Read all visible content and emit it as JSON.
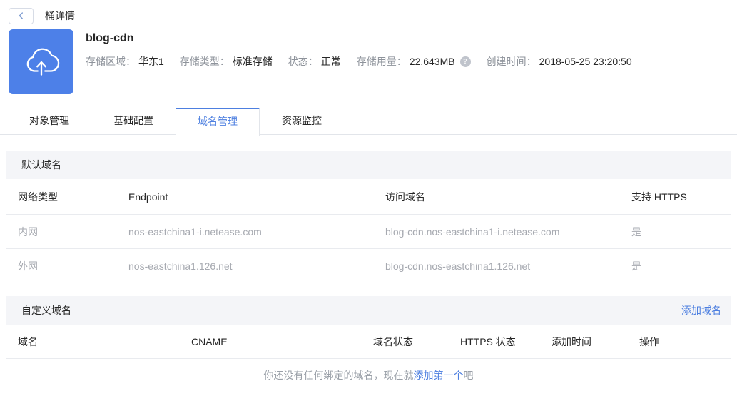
{
  "topbar": {
    "title": "桶详情"
  },
  "bucket": {
    "name": "blog-cdn",
    "info": [
      {
        "label": "存储区域：",
        "value": "华东1"
      },
      {
        "label": "存储类型：",
        "value": "标准存储"
      },
      {
        "label": "状态：",
        "value": "正常"
      },
      {
        "label": "存储用量：",
        "value": "22.643MB"
      },
      {
        "label": "创建时间：",
        "value": "2018-05-25 23:20:50"
      }
    ],
    "help_icon_glyph": "?"
  },
  "tabs": [
    {
      "label": "对象管理",
      "active": false
    },
    {
      "label": "基础配置",
      "active": false
    },
    {
      "label": "域名管理",
      "active": true
    },
    {
      "label": "资源监控",
      "active": false
    }
  ],
  "default_domain": {
    "section_title": "默认域名",
    "columns": [
      "网络类型",
      "Endpoint",
      "访问域名",
      "支持 HTTPS"
    ],
    "rows": [
      {
        "network": "内网",
        "endpoint": "nos-eastchina1-i.netease.com",
        "access_domain": "blog-cdn.nos-eastchina1-i.netease.com",
        "https": "是"
      },
      {
        "network": "外网",
        "endpoint": "nos-eastchina1.126.net",
        "access_domain": "blog-cdn.nos-eastchina1.126.net",
        "https": "是"
      }
    ]
  },
  "custom_domain": {
    "section_title": "自定义域名",
    "add_link": "添加域名",
    "columns": [
      "域名",
      "CNAME",
      "域名状态",
      "HTTPS 状态",
      "添加时间",
      "操作"
    ],
    "empty_state": {
      "prefix": "你还没有任何绑定的域名，现在就",
      "link": "添加第一个",
      "suffix": "吧"
    }
  },
  "colors": {
    "accent": "#4d7fe0",
    "icon_bg": "#4d80e8"
  }
}
